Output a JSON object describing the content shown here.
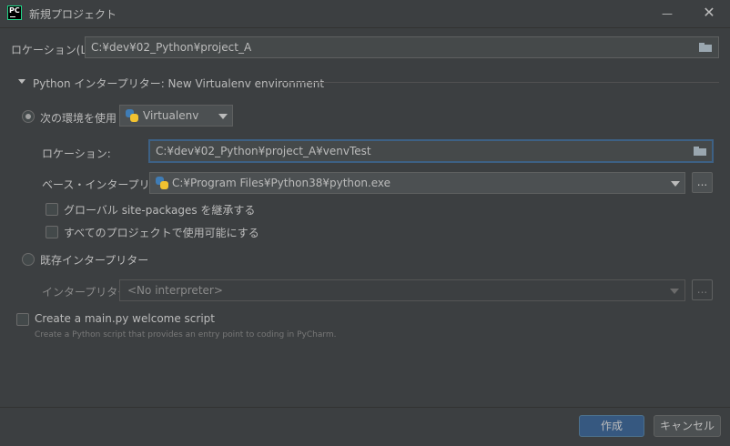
{
  "window": {
    "title": "新規プロジェクト",
    "app_icon_text": "PC",
    "minimize": "—",
    "close": "✕"
  },
  "location": {
    "label": "ロケーション(L):",
    "value": "C:¥dev¥02_Python¥project_A"
  },
  "interpreter_section": {
    "title": "Python インタープリター: New Virtualenv environment",
    "new_env": {
      "radio_label": "次の環境を使用",
      "env_type": "Virtualenv",
      "location_label": "ロケーション:",
      "location_value": "C:¥dev¥02_Python¥project_A¥venvTest",
      "base_label": "ベース・インタープリター:",
      "base_value": "C:¥Program Files¥Python38¥python.exe",
      "browse": "...",
      "inherit_label": "グローバル site-packages を継承する",
      "all_projects_label": "すべてのプロジェクトで使用可能にする"
    },
    "existing": {
      "radio_label": "既存インタープリター",
      "interpreter_label": "インタープリター:",
      "interpreter_value": "<No interpreter>",
      "browse": "..."
    }
  },
  "welcome": {
    "checkbox_label": "Create a main.py welcome script",
    "hint": "Create a Python script that provides an entry point to coding in PyCharm."
  },
  "buttons": {
    "create": "作成",
    "cancel": "キャンセル"
  },
  "colors": {
    "background": "#3c3f41",
    "field": "#45494a",
    "focus": "#3d6185",
    "primary_button": "#365880"
  }
}
